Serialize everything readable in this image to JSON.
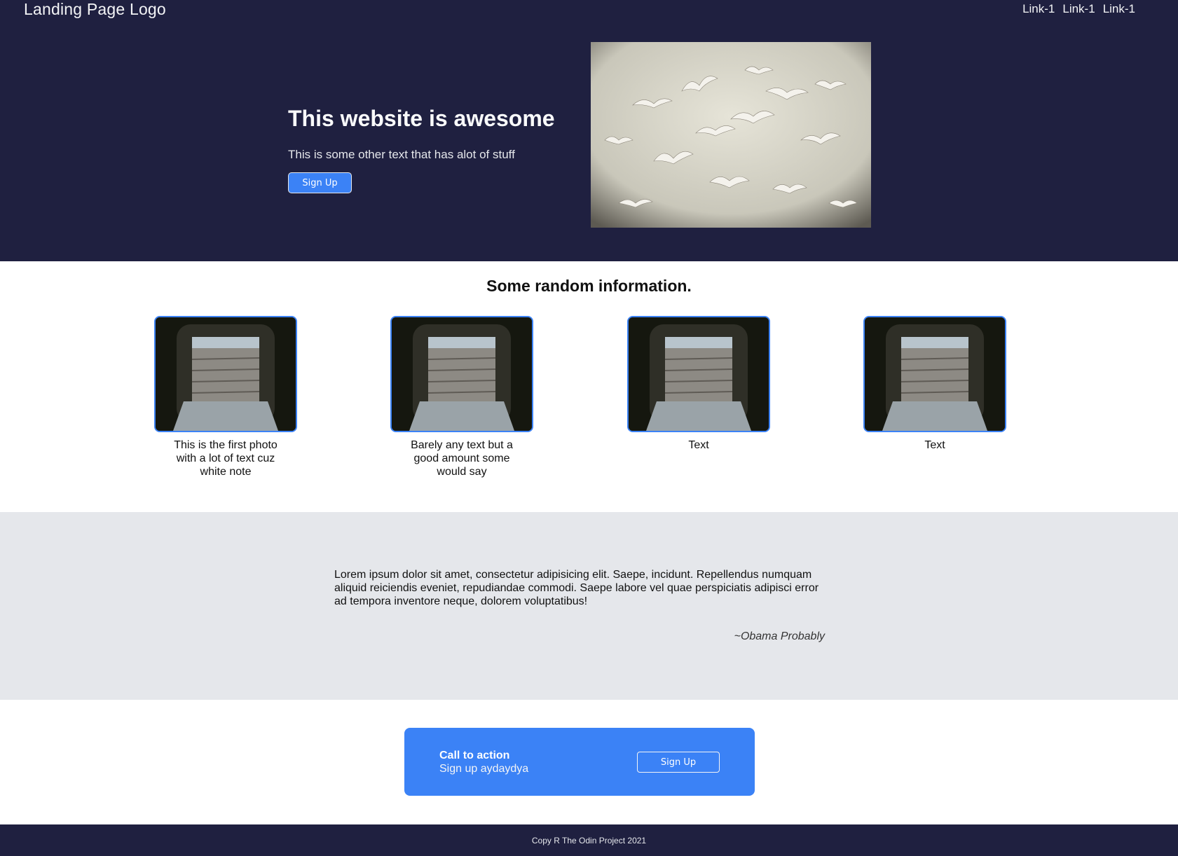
{
  "header": {
    "logo": "Landing Page Logo",
    "nav_links": [
      "Link-1",
      "Link-1",
      "Link-1"
    ]
  },
  "hero": {
    "title": "This website is awesome",
    "subtitle": "This is some other text that has alot of stuff",
    "button_label": "Sign Up",
    "image": "seagulls-photo"
  },
  "info": {
    "title": "Some random information.",
    "cards": [
      {
        "image": "window-rooftops-photo",
        "caption": "This is the first photo with a lot of text cuz white note"
      },
      {
        "image": "window-rooftops-photo",
        "caption": "Barely any text but a good amount some would say"
      },
      {
        "image": "window-rooftops-photo",
        "caption": "Text"
      },
      {
        "image": "window-rooftops-photo",
        "caption": "Text"
      }
    ]
  },
  "quote": {
    "text": "Lorem ipsum dolor sit amet, consectetur adipisicing elit. Saepe, incidunt. Repellendus numquam aliquid reiciendis eveniet, repudiandae commodi. Saepe labore vel quae perspiciatis adipisci error ad tempora inventore neque, dolorem voluptatibus!",
    "author": "~Obama Probably"
  },
  "cta": {
    "title": "Call to action",
    "subtitle": "Sign up aydaydya",
    "button_label": "Sign Up"
  },
  "footer": {
    "text": "Copy R The Odin Project 2021"
  },
  "colors": {
    "dark_bg": "#1f2040",
    "accent": "#3b82f6",
    "quote_bg": "#e5e7eb"
  }
}
